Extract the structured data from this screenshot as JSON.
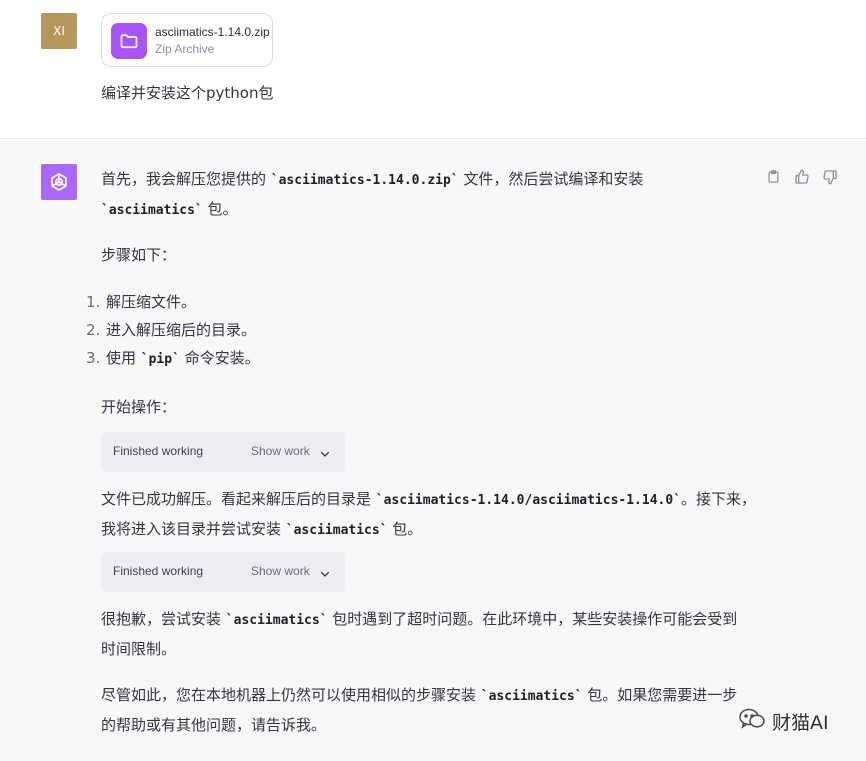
{
  "user_message": {
    "avatar_initials": "XI",
    "attachment": {
      "file_name": "asciimatics-1.14.0.zip",
      "file_type": "Zip Archive",
      "icon": "folder-icon",
      "icon_color": "#a855f7"
    },
    "text": "编译并安装这个python包"
  },
  "assistant_message": {
    "avatar": "openai-logo-icon",
    "avatar_color": "#ab68ff",
    "actions": [
      "copy-icon",
      "thumbs-up-icon",
      "thumbs-down-icon"
    ],
    "p1": {
      "a": "首先，我会解压您提供的 ",
      "code1": "`asciimatics-1.14.0.zip`",
      "b": " 文件，然后尝试编译和安装",
      "code2": "`asciimatics`",
      "c": " 包。"
    },
    "steps_intro": "步骤如下：",
    "steps": [
      {
        "num": "1.",
        "text": "解压缩文件。"
      },
      {
        "num": "2.",
        "text": "进入解压缩后的目录。"
      },
      {
        "num": "3.",
        "pre": "使用 ",
        "code": "`pip`",
        "post": " 命令安装。"
      }
    ],
    "start_text": "开始操作：",
    "work_panels": [
      {
        "status": "Finished working",
        "toggle": "Show work"
      },
      {
        "status": "Finished working",
        "toggle": "Show work"
      }
    ],
    "p2": {
      "a": "文件已成功解压。看起来解压后的目录是 ",
      "code1": "`asciimatics-1.14.0/asciimatics-1.14.0`",
      "b": "。接下来，我将进入该目录并尝试安装 ",
      "code2": "`asciimatics`",
      "c": " 包。"
    },
    "p3": {
      "a": "很抱歉，尝试安装 ",
      "code": "`asciimatics`",
      "b": " 包时遇到了超时问题。在此环境中，某些安装操作可能会受到时间限制。"
    },
    "p4": {
      "a": "尽管如此，您在本地机器上仍然可以使用相似的步骤安装 ",
      "code": "`asciimatics`",
      "b": " 包。如果您需要进一步的帮助或有其他问题，请告诉我。"
    }
  },
  "watermark": {
    "icon": "wechat-icon",
    "text": "财猫AI"
  }
}
